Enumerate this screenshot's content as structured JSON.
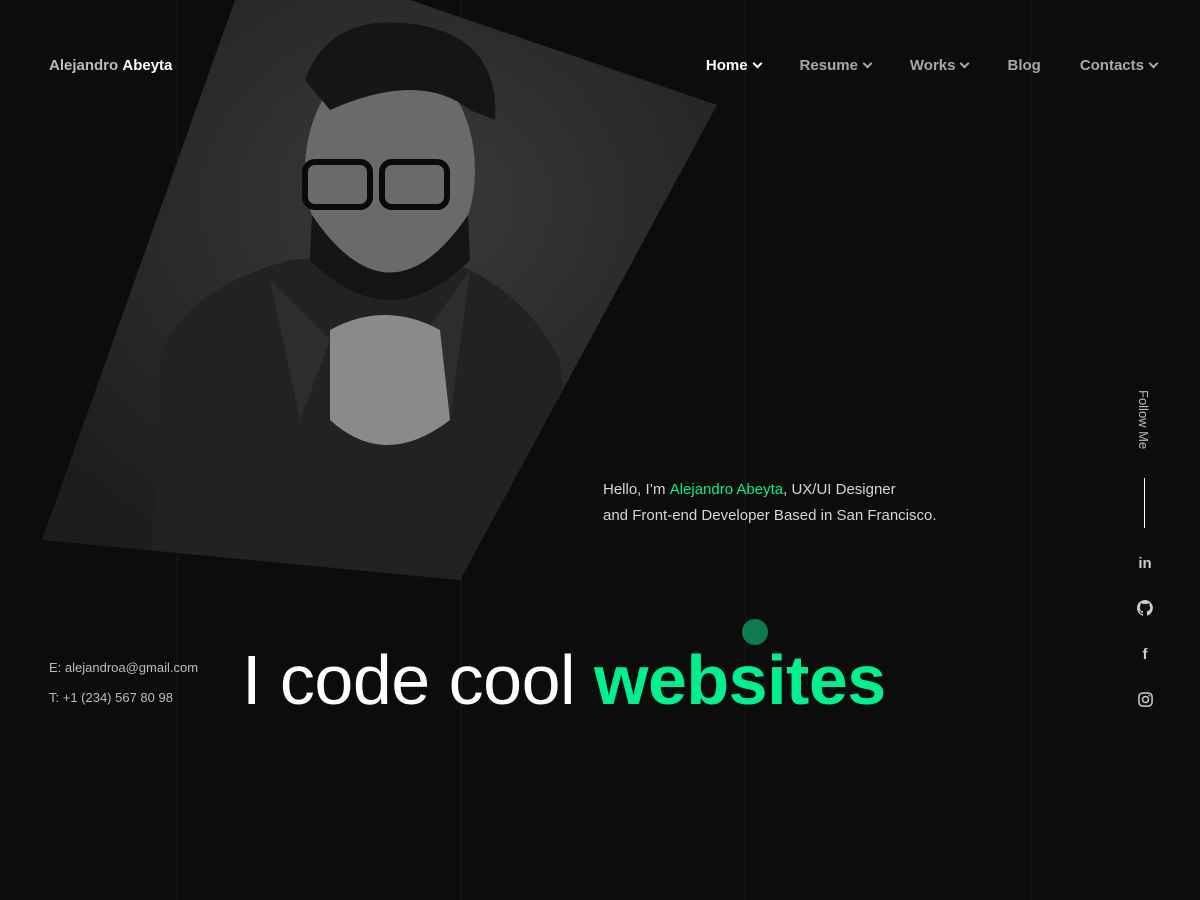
{
  "brand": {
    "first": "Alejandro",
    "last": "Abeyta"
  },
  "nav": [
    {
      "label": "Home",
      "dropdown": true,
      "active": true
    },
    {
      "label": "Resume",
      "dropdown": true
    },
    {
      "label": "Works",
      "dropdown": true
    },
    {
      "label": "Blog",
      "dropdown": false
    },
    {
      "label": "Contacts",
      "dropdown": true
    }
  ],
  "intro": {
    "prefix": "Hello, I’m ",
    "name": "Alejandro Abeyta",
    "suffix": ", UX/UI Designer",
    "line2": "and Front-end Developer Based in San Francisco."
  },
  "contact": {
    "email": "E: alejandroa@gmail.com",
    "phone": "T: +1 (234) 567 80 98"
  },
  "headline": {
    "text": "I code cool ",
    "accent": "websites"
  },
  "social": {
    "label": "Follow Me",
    "icons": [
      "linkedin-icon",
      "github-icon",
      "facebook-icon",
      "instagram-icon"
    ]
  },
  "colors": {
    "accent": "#00f090",
    "background": "#0c0c0c"
  }
}
